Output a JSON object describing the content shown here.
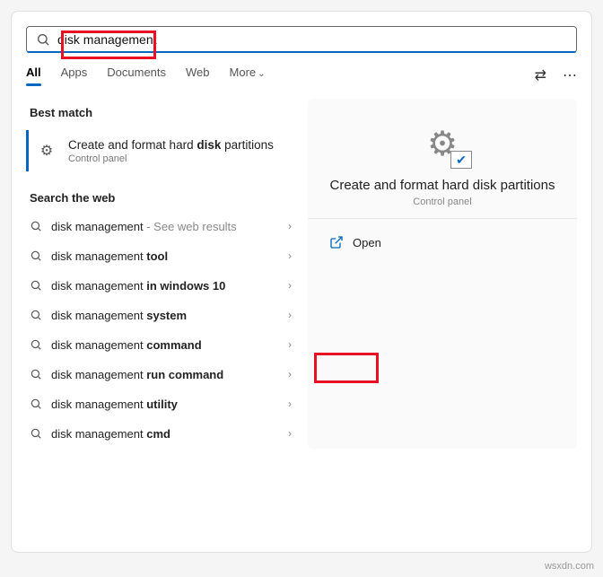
{
  "search": {
    "query": "disk management"
  },
  "tabs": {
    "all": "All",
    "apps": "Apps",
    "documents": "Documents",
    "web": "Web",
    "more": "More"
  },
  "sections": {
    "best_match": "Best match",
    "search_web": "Search the web"
  },
  "best": {
    "title_pre": "Create and format hard ",
    "title_bold": "disk",
    "title_post": " partitions",
    "subtitle": "Control panel"
  },
  "web_items": [
    {
      "pre": "disk management",
      "bold": "",
      "hint": " - See web results"
    },
    {
      "pre": "disk management ",
      "bold": "tool",
      "hint": ""
    },
    {
      "pre": "disk management ",
      "bold": "in windows 10",
      "hint": ""
    },
    {
      "pre": "disk management ",
      "bold": "system",
      "hint": ""
    },
    {
      "pre": "disk management ",
      "bold": "command",
      "hint": ""
    },
    {
      "pre": "disk management ",
      "bold": "run command",
      "hint": ""
    },
    {
      "pre": "disk management ",
      "bold": "utility",
      "hint": ""
    },
    {
      "pre": "disk management ",
      "bold": "cmd",
      "hint": ""
    }
  ],
  "detail": {
    "title": "Create and format hard disk partitions",
    "subtitle": "Control panel",
    "open": "Open"
  },
  "watermark": "wsxdn.com"
}
